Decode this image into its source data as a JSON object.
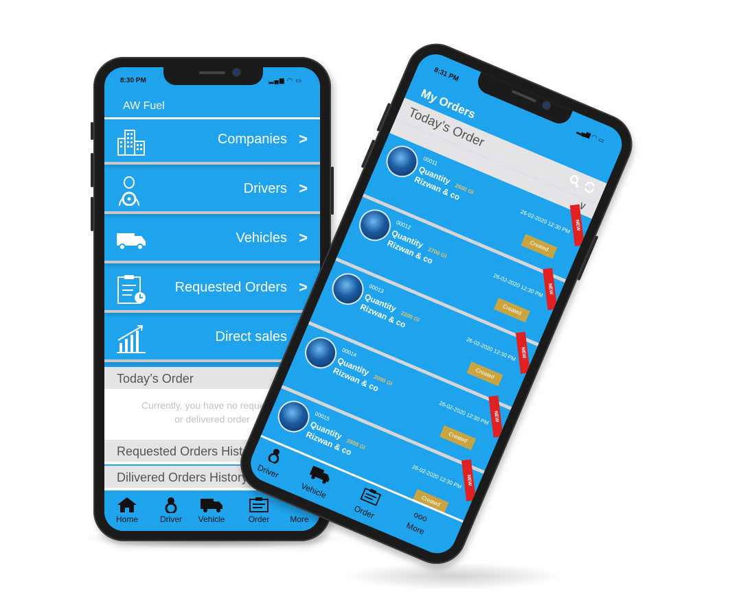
{
  "phone1": {
    "status": {
      "time": "8:30 PM",
      "icons": "▂▄▆ ◠ ▭"
    },
    "app_title": "AW Fuel",
    "menu": [
      {
        "label": "Companies",
        "icon": "buildings-icon"
      },
      {
        "label": "Drivers",
        "icon": "driver-icon"
      },
      {
        "label": "Vehicles",
        "icon": "truck-icon"
      },
      {
        "label": "Requested Orders",
        "icon": "clipboard-clock-icon"
      },
      {
        "label": "Direct sales",
        "icon": "bar-chart-icon"
      }
    ],
    "chevron": ">",
    "today_order": {
      "label": "Today’s Order",
      "chevron": "∨"
    },
    "empty_message": {
      "line1": "Currently, you have no requested",
      "line2": "or delivered order"
    },
    "history": [
      {
        "label": "Requested Orders History"
      },
      {
        "label": "Dilivered Orders History"
      }
    ],
    "tabs": [
      {
        "label": "Home",
        "icon": "home-icon"
      },
      {
        "label": "Driver",
        "icon": "driver-icon"
      },
      {
        "label": "Vehicle",
        "icon": "truck-icon"
      },
      {
        "label": "Order",
        "icon": "order-icon"
      },
      {
        "label": "More",
        "icon": "more-icon",
        "glyph": "ooo"
      }
    ]
  },
  "phone2": {
    "status": {
      "time": "8:31 PM",
      "icons": "▂▄▆ ◠ ▭"
    },
    "title": "My Orders",
    "today_order": {
      "label": "Today’s Order",
      "chevron": "∨"
    },
    "orders": [
      {
        "id": "00011",
        "qty_label": "Quantity",
        "amount": "2500 Gl",
        "company": "Rizwan & co",
        "date": "26-02-2020 12:30 PM",
        "status": "Created",
        "ribbon": "NEW"
      },
      {
        "id": "00012",
        "qty_label": "Quantity",
        "amount": "2700 Gl",
        "company": "Rizwan & co",
        "date": "26-02-2020 12:30 PM",
        "status": "Created",
        "ribbon": "NEW"
      },
      {
        "id": "00013",
        "qty_label": "Quantity",
        "amount": "2200 Gl",
        "company": "Rizwan & co",
        "date": "26-02-2020 12:30 PM",
        "status": "Created",
        "ribbon": "NEW"
      },
      {
        "id": "00014",
        "qty_label": "Quantity",
        "amount": "2000 Gl",
        "company": "Rizwan & co",
        "date": "26-02-2020 12:30 PM",
        "status": "Created",
        "ribbon": "NEW"
      },
      {
        "id": "00015",
        "qty_label": "Quantity",
        "amount": "2900 Gl",
        "company": "Rizwan & co",
        "date": "26-02-2020 12:30 PM",
        "status": "Created",
        "ribbon": "NEW"
      }
    ],
    "tabs": [
      {
        "label": "Driver",
        "icon": "driver-icon"
      },
      {
        "label": "Vehicle",
        "icon": "truck-icon"
      },
      {
        "label": "Order",
        "icon": "order-icon"
      },
      {
        "label": "More",
        "icon": "more-icon",
        "glyph": "ooo"
      }
    ]
  },
  "colors": {
    "primary": "#1fa3ec",
    "gold": "#c9a440",
    "ribbon": "#e02121",
    "gray_bar": "#e4e4e6"
  }
}
